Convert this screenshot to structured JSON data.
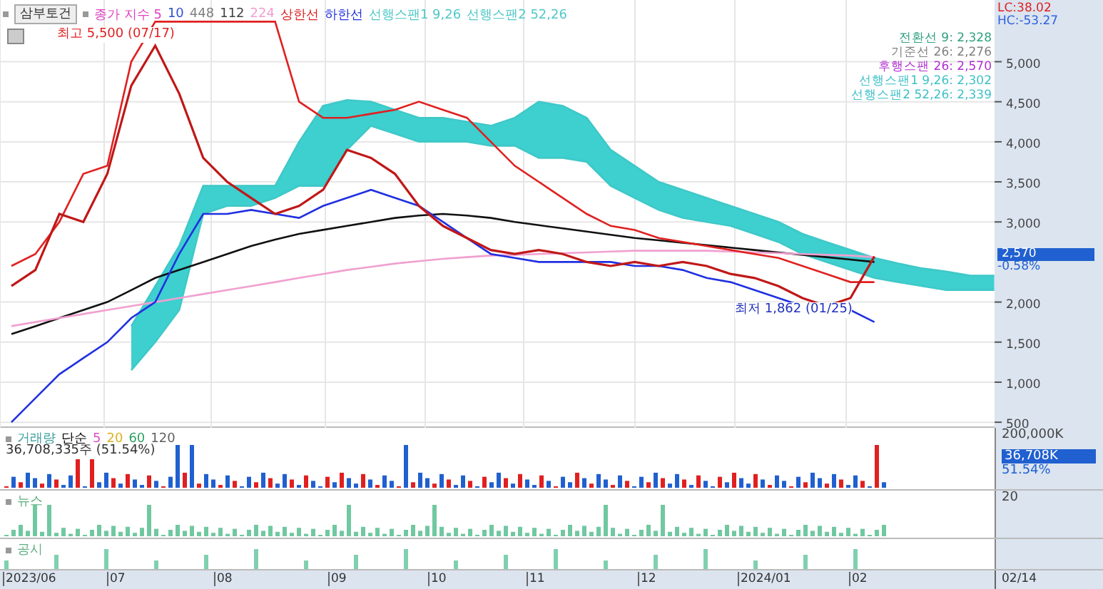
{
  "stock": {
    "name": "삼부토건"
  },
  "legend": [
    {
      "label": "종가 지수 5",
      "color": "#e040c0"
    },
    {
      "label": "10",
      "color": "#3050d0"
    },
    {
      "label": "448",
      "color": "#808080"
    },
    {
      "label": "112",
      "color": "#404040"
    },
    {
      "label": "224",
      "color": "#f0a0d0"
    },
    {
      "label": "상한선",
      "color": "#e02020"
    },
    {
      "label": "하한선",
      "color": "#2030e0"
    },
    {
      "label": "선행스팬1 9,26",
      "color": "#50c8c8"
    },
    {
      "label": "선행스팬2 52,26",
      "color": "#50c8c8"
    }
  ],
  "indicators": [
    {
      "label": "전환선 9: 2,328",
      "color": "#30a080"
    },
    {
      "label": "기준선 26: 2,276",
      "color": "#808080"
    },
    {
      "label": "후행스팬 26: 2,570",
      "color": "#b030d0"
    },
    {
      "label": "선행스팬1 9,26: 2,302",
      "color": "#40c0c8"
    },
    {
      "label": "선행스팬2 52,26: 2,339",
      "color": "#40c0c8"
    }
  ],
  "oscillator": {
    "lc": "LC:38.02",
    "hc": "HC:-53.27"
  },
  "high_label": "최고 5,500 (07/17)",
  "low_label": "최저 1,862 (01/25)",
  "price_tag": {
    "price": "2,570",
    "change": "-0.58%"
  },
  "price_axis": {
    "labels": [
      "5,000",
      "4,500",
      "4,000",
      "3,500",
      "3,000",
      "2,000",
      "1,500",
      "1,000",
      "500"
    ]
  },
  "volume": {
    "title": "거래량",
    "ma_label": "단순",
    "ma": [
      {
        "label": "5",
        "color": "#e050c0"
      },
      {
        "label": "20",
        "color": "#e0b020"
      },
      {
        "label": "60",
        "color": "#30a060"
      },
      {
        "label": "120",
        "color": "#606060"
      }
    ],
    "summary": "36,708,335주 (51.54%)",
    "axis_label": "200,000K",
    "tag": "36,708K",
    "tag_pct": "51.54%"
  },
  "news": {
    "title": "뉴스",
    "axis_label": "20"
  },
  "disclosure": {
    "title": "공시"
  },
  "date_axis": {
    "labels": [
      "2023/06",
      "07",
      "08",
      "09",
      "10",
      "11",
      "12",
      "2024/01",
      "02"
    ],
    "end": "02/14"
  }
}
